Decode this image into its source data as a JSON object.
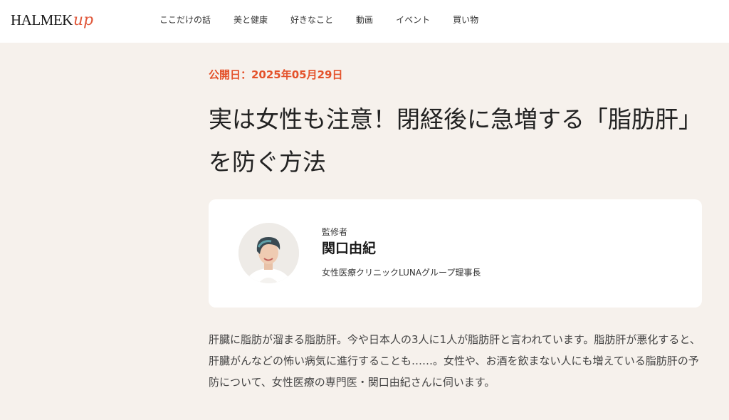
{
  "header": {
    "logo_main": "HALMEK",
    "logo_accent": "up",
    "nav": [
      "ここだけの話",
      "美と健康",
      "好きなこと",
      "動画",
      "イベント",
      "買い物"
    ]
  },
  "article": {
    "published": "公開日：2025年05月29日",
    "title": "実は女性も注意！閉経後に急増する「脂肪肝」を防ぐ方法",
    "supervisor": {
      "label": "監修者",
      "name": "関口由紀",
      "role": "女性医療クリニックLUNAグループ理事長"
    },
    "lead": "肝臓に脂肪が溜まる脂肪肝。今や日本人の3人に1人が脂肪肝と言われています。脂肪肝が悪化すると、肝臓がんなどの怖い病気に進行することも……。女性や、お酒を飲まない人にも増えている脂肪肝の予防について、女性医療の専門医・関口由紀さんに伺います。"
  },
  "colors": {
    "accent": "#e4522b",
    "page_bg": "#f6f1ec"
  }
}
